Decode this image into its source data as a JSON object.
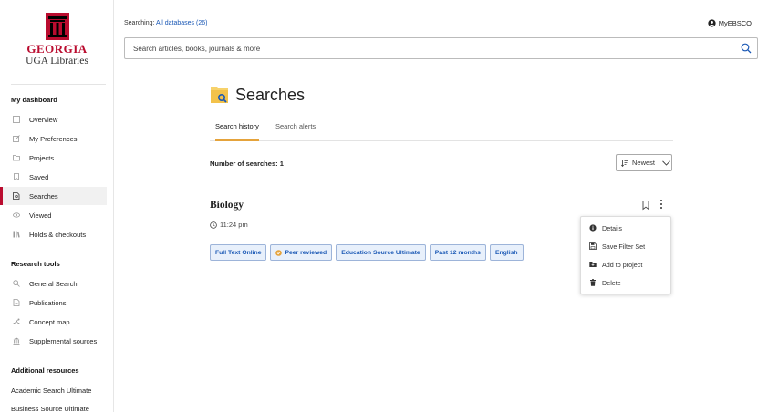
{
  "logo": {
    "name": "GEORGIA",
    "subtitle": "UGA Libraries"
  },
  "sidebar": {
    "dashboard_title": "My dashboard",
    "dashboard_items": [
      {
        "label": "Overview",
        "icon": "overview-icon"
      },
      {
        "label": "My Preferences",
        "icon": "preferences-icon"
      },
      {
        "label": "Projects",
        "icon": "folder-icon"
      },
      {
        "label": "Saved",
        "icon": "bookmark-icon"
      },
      {
        "label": "Searches",
        "icon": "searches-icon",
        "active": true
      },
      {
        "label": "Viewed",
        "icon": "eye-icon"
      },
      {
        "label": "Holds & checkouts",
        "icon": "books-icon"
      }
    ],
    "research_title": "Research tools",
    "research_items": [
      {
        "label": "General Search",
        "icon": "search-icon"
      },
      {
        "label": "Publications",
        "icon": "document-icon"
      },
      {
        "label": "Concept map",
        "icon": "concept-map-icon"
      },
      {
        "label": "Supplemental sources",
        "icon": "library-icon"
      }
    ],
    "additional_title": "Additional resources",
    "additional_items": [
      {
        "label": "Academic Search Ultimate"
      },
      {
        "label": "Business Source Ultimate"
      }
    ]
  },
  "header": {
    "searching_label": "Searching:",
    "databases": "All databases (26)",
    "account_label": "MyEBSCO",
    "search_placeholder": "Search articles, books, journals & more"
  },
  "main": {
    "title": "Searches",
    "tabs": [
      {
        "label": "Search history",
        "active": true
      },
      {
        "label": "Search alerts",
        "active": false
      }
    ],
    "count_label": "Number of searches: 1",
    "sort_value": "Newest",
    "result": {
      "title": "Biology",
      "time": "11:24 pm",
      "filters": [
        {
          "label": "Full Text Online"
        },
        {
          "label": "Peer reviewed",
          "icon": "peer-reviewed-icon"
        },
        {
          "label": "Education Source Ultimate"
        },
        {
          "label": "Past 12 months"
        },
        {
          "label": "English"
        }
      ]
    },
    "menu": [
      {
        "label": "Details",
        "icon": "info-icon"
      },
      {
        "label": "Save Filter Set",
        "icon": "save-icon"
      },
      {
        "label": "Add to project",
        "icon": "folder-add-icon"
      },
      {
        "label": "Delete",
        "icon": "trash-icon"
      }
    ]
  },
  "colors": {
    "brand_red": "#ba0c2f",
    "link_blue": "#1a58b5",
    "tab_underline": "#e5a33b",
    "chip_bg": "#e8f0fb",
    "chip_border": "#9db4d9"
  }
}
